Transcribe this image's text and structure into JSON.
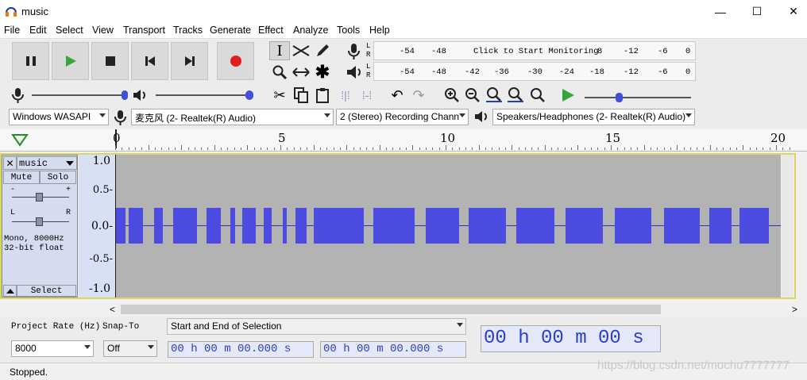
{
  "window": {
    "title": "music",
    "minimize": "—",
    "maximize": "☐",
    "close": "✕"
  },
  "menu": [
    "File",
    "Edit",
    "Select",
    "View",
    "Transport",
    "Tracks",
    "Generate",
    "Effect",
    "Analyze",
    "Tools",
    "Help"
  ],
  "meters": {
    "record_ticks": [
      "-54",
      "-48",
      "Click to Start Monitoring",
      "8",
      "-12",
      "-6",
      "0"
    ],
    "play_ticks": [
      "-54",
      "-48",
      "-42",
      "-36",
      "-30",
      "-24",
      "-18",
      "-12",
      "-6",
      "0"
    ],
    "channels": [
      "L",
      "R"
    ]
  },
  "devices": {
    "host": "Windows WASAPI",
    "recording_device": "麦克风 (2- Realtek(R) Audio)",
    "channels": "2 (Stereo) Recording Chann",
    "playback_device": "Speakers/Headphones (2- Realtek(R) Audio)"
  },
  "timeline": {
    "labels": [
      "0",
      "5",
      "10",
      "15",
      "20"
    ]
  },
  "track": {
    "name": "music",
    "mute": "Mute",
    "solo": "Solo",
    "gain_minus": "-",
    "gain_plus": "+",
    "pan_left": "L",
    "pan_right": "R",
    "info_line1": "Mono, 8000Hz",
    "info_line2": "32-bit float",
    "select": "Select",
    "y_labels": [
      "1.0",
      "0.5-",
      "0.0-",
      "-0.5-",
      "-1.0"
    ]
  },
  "selection_bar": {
    "project_rate_label": "Project Rate (Hz)",
    "project_rate": "8000",
    "snap_to_label": "Snap-To",
    "snap_to": "Off",
    "selection_mode": "Start and End of Selection",
    "start_time": "00 h 00 m 00.000 s",
    "end_time": "00 h 00 m 00.000 s",
    "audio_position": "00 h 00 m 00 s"
  },
  "status": {
    "text": "Stopped."
  },
  "watermark": "https://blog.csdn.net/mochu7777777",
  "colors": {
    "waveform": "#4c4de0",
    "record": "#e02020",
    "play": "#3aa53a",
    "time_text": "#2a3ec8"
  }
}
